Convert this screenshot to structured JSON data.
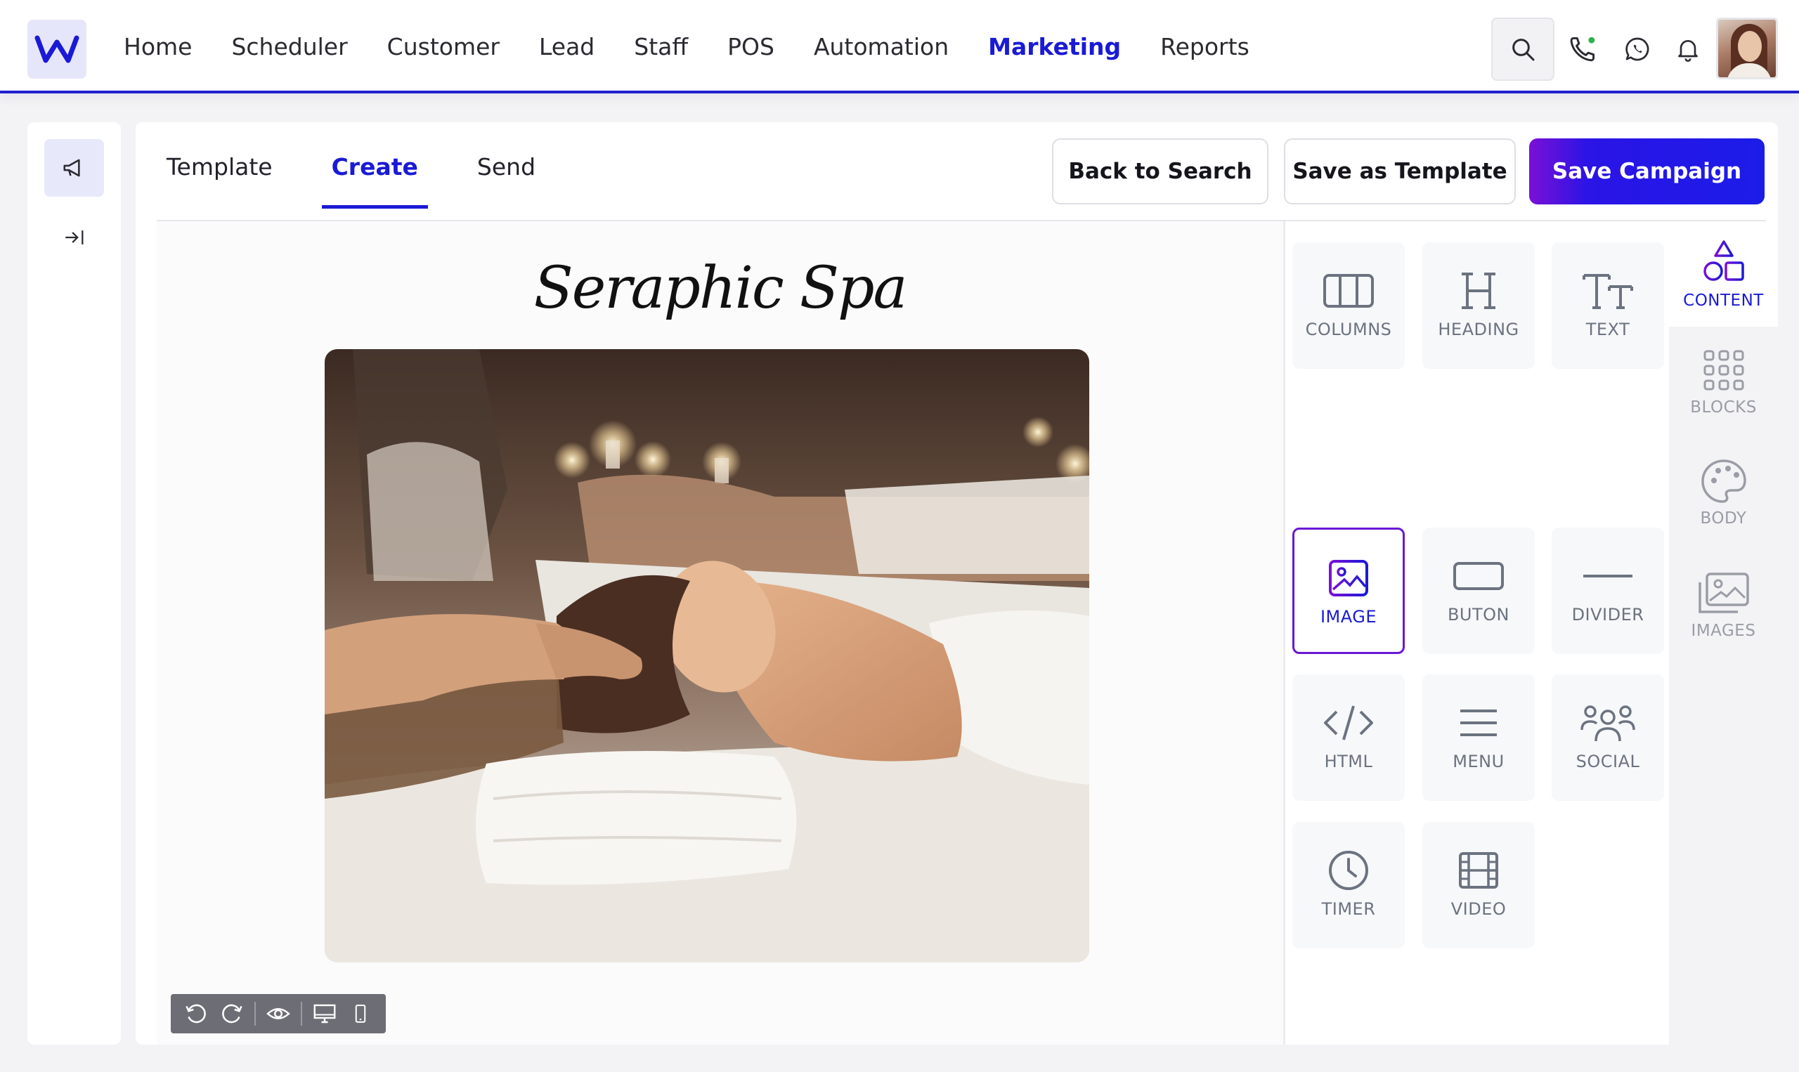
{
  "nav": {
    "items": [
      "Home",
      "Scheduler",
      "Customer",
      "Lead",
      "Staff",
      "POS",
      "Automation",
      "Marketing",
      "Reports"
    ],
    "active": "Marketing"
  },
  "tabs": {
    "items": [
      "Template",
      "Create",
      "Send"
    ],
    "active": "Create"
  },
  "actions": {
    "back": "Back to Search",
    "save_template": "Save as Template",
    "save_campaign": "Save Campaign"
  },
  "canvas": {
    "title": "Seraphic Spa"
  },
  "tools": [
    "COLUMNS",
    "HEADING",
    "TEXT",
    "IMAGE",
    "BUTON",
    "DIVIDER",
    "HTML",
    "MENU",
    "SOCIAL",
    "TIMER",
    "VIDEO"
  ],
  "selected_tool": "IMAGE",
  "categories": [
    "CONTENT",
    "BLOCKS",
    "BODY",
    "IMAGES"
  ],
  "active_category": "CONTENT",
  "colors": {
    "brand": "#1a1ad6",
    "accent_gradient_start": "#7a10d6"
  },
  "icons": {
    "logo": "w-logo-icon",
    "search": "search-icon",
    "phone": "phone-icon",
    "whatsapp": "whatsapp-icon",
    "bell": "bell-icon"
  }
}
